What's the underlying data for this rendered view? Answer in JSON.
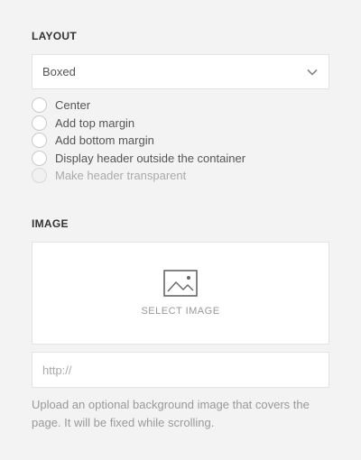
{
  "layout": {
    "title": "LAYOUT",
    "select": {
      "value": "Boxed"
    },
    "options": [
      {
        "label": "Center",
        "checked": false,
        "disabled": false
      },
      {
        "label": "Add top margin",
        "checked": false,
        "disabled": false
      },
      {
        "label": "Add bottom margin",
        "checked": false,
        "disabled": false
      },
      {
        "label": "Display header outside the container",
        "checked": false,
        "disabled": false
      },
      {
        "label": "Make header transparent",
        "checked": false,
        "disabled": true
      }
    ]
  },
  "image": {
    "title": "IMAGE",
    "select_label": "SELECT IMAGE",
    "url_placeholder": "http://",
    "url_value": "",
    "help": "Upload an optional background image that covers the page. It will be fixed while scrolling."
  },
  "icons": {
    "select_chevron": "chevron-down-icon",
    "image_placeholder": "image-icon"
  },
  "colors": {
    "background": "#f3f3f3",
    "border": "#e3e3e3",
    "muted_text": "#999999"
  }
}
